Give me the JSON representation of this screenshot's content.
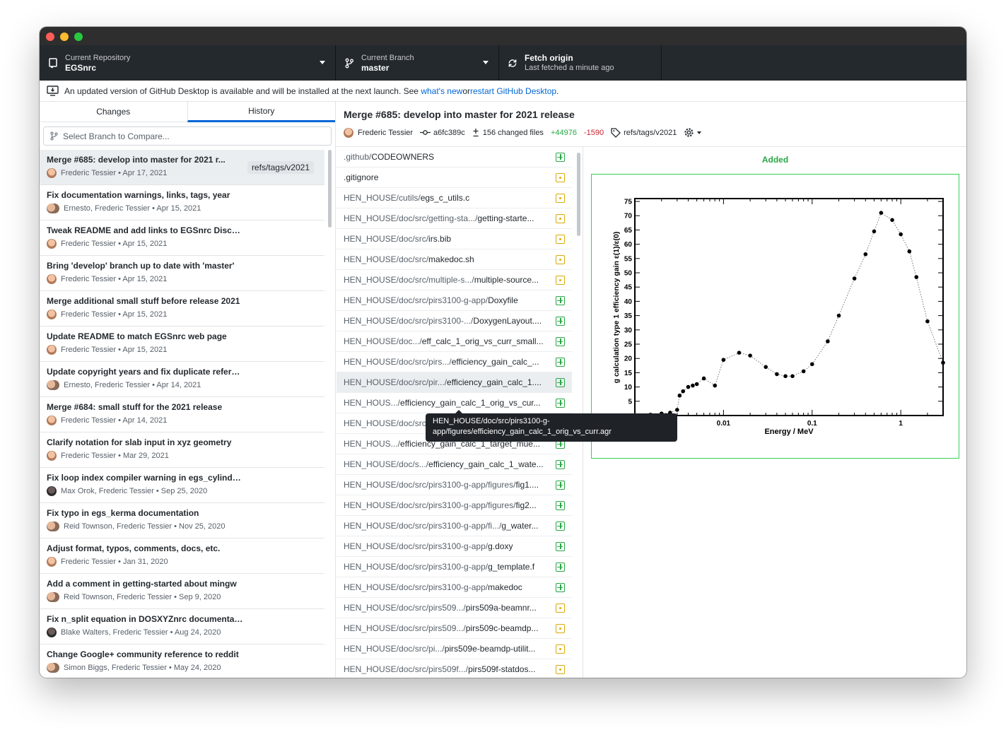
{
  "toolbar": {
    "repo_label": "Current Repository",
    "repo_value": "EGSnrc",
    "branch_label": "Current Branch",
    "branch_value": "master",
    "fetch_label": "Fetch origin",
    "fetch_sub": "Last fetched a minute ago"
  },
  "banner": {
    "text": "An updated version of GitHub Desktop is available and will be installed at the next launch. See ",
    "link1": "what's new",
    "mid": " or ",
    "link2": "restart GitHub Desktop",
    "end": "."
  },
  "sidebar": {
    "tab_changes": "Changes",
    "tab_history": "History",
    "compare_placeholder": "Select Branch to Compare...",
    "commits": [
      {
        "title": "Merge #685: develop into master for 2021 r...",
        "meta": "Frederic Tessier • Apr 17, 2021",
        "tag": "refs/tags/v2021",
        "avatar": "single"
      },
      {
        "title": "Fix documentation warnings, links, tags, year",
        "meta": "Ernesto, Frederic Tessier • Apr 15, 2021",
        "avatar": "duo"
      },
      {
        "title": "Tweak README and add links to EGSnrc Discussions",
        "meta": "Frederic Tessier • Apr 15, 2021",
        "avatar": "single"
      },
      {
        "title": "Bring 'develop' branch up to date with 'master'",
        "meta": "Frederic Tessier • Apr 15, 2021",
        "avatar": "single"
      },
      {
        "title": "Merge additional small stuff before release 2021",
        "meta": "Frederic Tessier • Apr 15, 2021",
        "avatar": "single"
      },
      {
        "title": "Update README to match EGSnrc web page",
        "meta": "Frederic Tessier • Apr 15, 2021",
        "avatar": "single"
      },
      {
        "title": "Update copyright years and fix duplicate reference",
        "meta": "Ernesto, Frederic Tessier • Apr 14, 2021",
        "avatar": "duo"
      },
      {
        "title": "Merge #684: small stuff for the 2021 release",
        "meta": "Frederic Tessier • Apr 14, 2021",
        "avatar": "single"
      },
      {
        "title": "Clarify notation for slab input in xyz geometry",
        "meta": "Frederic Tessier • Mar 29, 2021",
        "avatar": "single"
      },
      {
        "title": "Fix loop index compiler warning in egs_cylinders.h",
        "meta": "Max Orok, Frederic Tessier • Sep 25, 2020",
        "avatar": "dark"
      },
      {
        "title": "Fix typo in egs_kerma documentation",
        "meta": "Reid Townson, Frederic Tessier • Nov 25, 2020",
        "avatar": "duo"
      },
      {
        "title": "Adjust format, typos, comments, docs, etc.",
        "meta": "Frederic Tessier • Jan 31, 2020",
        "avatar": "single"
      },
      {
        "title": "Add a comment in getting-started about mingw",
        "meta": "Reid Townson, Frederic Tessier • Sep 9, 2020",
        "avatar": "duo"
      },
      {
        "title": "Fix n_split equation in DOSXYZnrc documentation",
        "meta": "Blake Walters, Frederic Tessier • Aug 24, 2020",
        "avatar": "dark"
      },
      {
        "title": "Change Google+ community reference to reddit",
        "meta": "Simon Biggs, Frederic Tessier • May 24, 2020",
        "avatar": "duo"
      }
    ]
  },
  "detail": {
    "title": "Merge #685: develop into master for 2021 release",
    "author": "Frederic Tessier",
    "sha": "a6fc389c",
    "changed": "156 changed files",
    "additions": "+44976",
    "deletions": "-1590",
    "tag": "refs/tags/v2021",
    "files": [
      {
        "dir": ".github/",
        "name": "CODEOWNERS",
        "status": "added"
      },
      {
        "dir": "",
        "name": ".gitignore",
        "status": "modified"
      },
      {
        "dir": "HEN_HOUSE/cutils/",
        "name": "egs_c_utils.c",
        "status": "modified"
      },
      {
        "dir": "HEN_HOUSE/doc/src/getting-sta.../",
        "name": "getting-starte...",
        "status": "modified"
      },
      {
        "dir": "HEN_HOUSE/doc/src/",
        "name": "irs.bib",
        "status": "modified"
      },
      {
        "dir": "HEN_HOUSE/doc/src/",
        "name": "makedoc.sh",
        "status": "modified"
      },
      {
        "dir": "HEN_HOUSE/doc/src/multiple-s.../",
        "name": "multiple-source...",
        "status": "modified"
      },
      {
        "dir": "HEN_HOUSE/doc/src/pirs3100-g-app/",
        "name": "Doxyfile",
        "status": "added"
      },
      {
        "dir": "HEN_HOUSE/doc/src/pirs3100-.../",
        "name": "DoxygenLayout....",
        "status": "added"
      },
      {
        "dir": "HEN_HOUSE/doc.../",
        "name": "eff_calc_1_orig_vs_curr_small...",
        "status": "added"
      },
      {
        "dir": "HEN_HOUSE/doc/src/pirs.../",
        "name": "efficiency_gain_calc_...",
        "status": "added"
      },
      {
        "dir": "HEN_HOUSE/doc/src/pir.../",
        "name": "efficiency_gain_calc_1....",
        "status": "added",
        "hover": true
      },
      {
        "dir": "HEN_HOUS.../",
        "name": "efficiency_gain_calc_1_orig_vs_cur...",
        "status": "added"
      },
      {
        "dir": "HEN_HOUSE/doc/src.../",
        "name": "efficiency_gain_calc_1_orig_vs_cur...",
        "status": "added"
      },
      {
        "dir": "HEN_HOUS.../",
        "name": "efficiency_gain_calc_1_target_mue...",
        "status": "added"
      },
      {
        "dir": "HEN_HOUSE/doc/s.../",
        "name": "efficiency_gain_calc_1_wate...",
        "status": "added"
      },
      {
        "dir": "HEN_HOUSE/doc/src/pirs3100-g-app/figures/",
        "name": "fig1....",
        "status": "added"
      },
      {
        "dir": "HEN_HOUSE/doc/src/pirs3100-g-app/figures/",
        "name": "fig2...",
        "status": "added"
      },
      {
        "dir": "HEN_HOUSE/doc/src/pirs3100-g-app/fi.../",
        "name": "g_water...",
        "status": "added"
      },
      {
        "dir": "HEN_HOUSE/doc/src/pirs3100-g-app/",
        "name": "g.doxy",
        "status": "added"
      },
      {
        "dir": "HEN_HOUSE/doc/src/pirs3100-g-app/",
        "name": "g_template.f",
        "status": "added"
      },
      {
        "dir": "HEN_HOUSE/doc/src/pirs3100-g-app/",
        "name": "makedoc",
        "status": "added"
      },
      {
        "dir": "HEN_HOUSE/doc/src/pirs509.../",
        "name": "pirs509a-beamnr...",
        "status": "modified"
      },
      {
        "dir": "HEN_HOUSE/doc/src/pirs509.../",
        "name": "pirs509c-beamdp...",
        "status": "modified"
      },
      {
        "dir": "HEN_HOUSE/doc/src/pi.../",
        "name": "pirs509e-beamdp-utilit...",
        "status": "modified"
      },
      {
        "dir": "HEN_HOUSE/doc/src/pirs509f.../",
        "name": "pirs509f-statdos...",
        "status": "modified"
      }
    ],
    "diff_label": "Added",
    "tooltip_line1": "HEN_HOUSE/doc/src/pirs3100-g-",
    "tooltip_line2": "app/figures/efficiency_gain_calc_1_orig_vs_curr.agr"
  },
  "plot": {
    "ylabel": "g calculation type 1 efficiency gain ε(1)/ε(0)",
    "xlabel": "Energy / MeV",
    "yticks": [
      "5",
      "10",
      "15",
      "20",
      "25",
      "30",
      "35",
      "40",
      "45",
      "50",
      "55",
      "60",
      "65",
      "70",
      "75"
    ],
    "xticks": [
      "0.01",
      "0.1",
      "1"
    ]
  },
  "chart_data": {
    "type": "scatter",
    "xlabel": "Energy / MeV",
    "ylabel": "g calculation type 1 efficiency gain ε(1)/ε(0)",
    "x_scale": "log",
    "xlim": [
      0.001,
      3
    ],
    "ylim": [
      0,
      76
    ],
    "x": [
      0.0015,
      0.002,
      0.0025,
      0.003,
      0.0032,
      0.0035,
      0.004,
      0.0045,
      0.005,
      0.006,
      0.008,
      0.01,
      0.015,
      0.02,
      0.03,
      0.04,
      0.05,
      0.06,
      0.08,
      0.1,
      0.15,
      0.2,
      0.3,
      0.4,
      0.5,
      0.6,
      0.8,
      1.0,
      1.25,
      1.5,
      2.0,
      3.0
    ],
    "y": [
      0.3,
      0.7,
      1.0,
      2.0,
      7.0,
      8.5,
      10.0,
      10.5,
      11.0,
      13.0,
      10.5,
      19.5,
      22.0,
      21.0,
      17.0,
      14.5,
      13.8,
      13.8,
      15.5,
      18.0,
      26.0,
      35.0,
      48.0,
      56.5,
      64.5,
      71.0,
      68.5,
      63.5,
      57.5,
      48.5,
      33.0,
      18.5
    ],
    "grid": false
  }
}
